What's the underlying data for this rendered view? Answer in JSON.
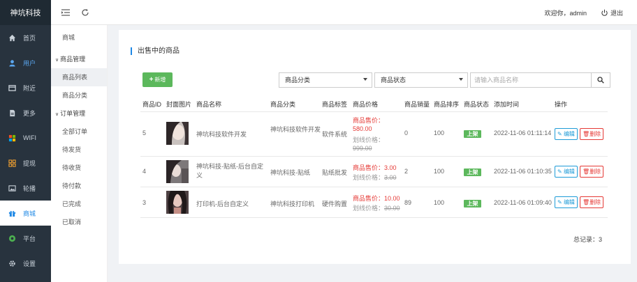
{
  "app": {
    "title": "神坑科技"
  },
  "sidebar": {
    "items": [
      {
        "label": "首页",
        "icon": "home-icon"
      },
      {
        "label": "用户",
        "icon": "user-icon"
      },
      {
        "label": "附近",
        "icon": "window-icon"
      },
      {
        "label": "更多",
        "icon": "document-icon"
      },
      {
        "label": "WIFI",
        "icon": "windows-icon"
      },
      {
        "label": "提现",
        "icon": "grid-icon"
      },
      {
        "label": "轮播",
        "icon": "image-icon"
      },
      {
        "label": "商城",
        "icon": "gift-icon"
      },
      {
        "label": "平台",
        "icon": "circle-icon"
      },
      {
        "label": "设置",
        "icon": "gear-icon"
      }
    ]
  },
  "topbar": {
    "welcome": "欢迎你，admin",
    "logout": "退出"
  },
  "submenu": {
    "top": "商城",
    "group1": "商品管理",
    "group1_items": [
      "商品列表",
      "商品分类"
    ],
    "group2": "订单管理",
    "group2_items": [
      "全部订单",
      "待发货",
      "待收货",
      "待付款",
      "已完成",
      "已取消"
    ]
  },
  "card": {
    "title": "出售中的商品",
    "add_label": "新增",
    "category_select": "商品分类",
    "status_select": "商品状态",
    "search_placeholder": "请输入商品名称"
  },
  "table": {
    "headers": [
      "商品ID",
      "封面图片",
      "商品名称",
      "商品分类",
      "商品标签",
      "商品价格",
      "商品销量",
      "商品排序",
      "商品状态",
      "添加时间",
      "操作"
    ],
    "rows": [
      {
        "id": "5",
        "name": "神坑科技软件开发",
        "category": "神坑科技软件开发",
        "tag": "软件系统",
        "price_label": "商品售价：",
        "price": "580.00",
        "old_label": "划线价格：",
        "old_price": "999.00",
        "sales": "0",
        "sort": "100",
        "status": "上架",
        "time": "2022-11-06 01:11:14",
        "edit": "编辑",
        "del": "删除"
      },
      {
        "id": "4",
        "name": "神坑科技-贴纸-后台自定义",
        "category": "神坑科技-贴纸",
        "tag": "贴纸批发",
        "price_label": "商品售价：",
        "price": "3.00",
        "old_label": "划线价格：",
        "old_price": "3.00",
        "sales": "2",
        "sort": "100",
        "status": "上架",
        "time": "2022-11-06 01:10:35",
        "edit": "编辑",
        "del": "删除"
      },
      {
        "id": "3",
        "name": "打印机-后台自定义",
        "category": "神坑科技打印机",
        "tag": "硬件购置",
        "price_label": "商品售价：",
        "price": "10.00",
        "old_label": "划线价格：",
        "old_price": "30.00",
        "sales": "89",
        "sort": "100",
        "status": "上架",
        "time": "2022-11-06 01:09:40",
        "edit": "编辑",
        "del": "删除"
      }
    ],
    "total": "总记录：3"
  },
  "colors": {
    "sidebar": "#28333e",
    "accent": "#1e88e5",
    "green": "#5cb85c",
    "red": "#e53935"
  }
}
